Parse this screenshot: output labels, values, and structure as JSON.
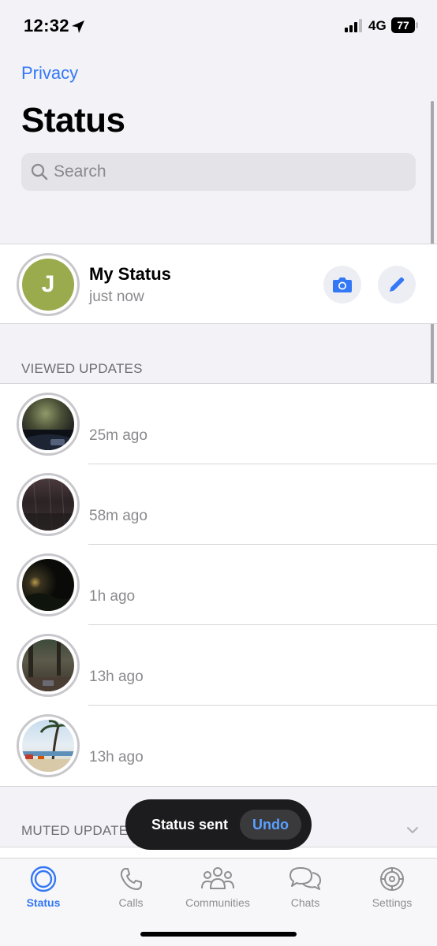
{
  "status_bar": {
    "time": "12:32",
    "network": "4G",
    "battery": "77"
  },
  "nav": {
    "privacy_label": "Privacy"
  },
  "page": {
    "title": "Status"
  },
  "search": {
    "placeholder": "Search"
  },
  "my_status": {
    "avatar_letter": "J",
    "name": "My Status",
    "subtitle": "just now"
  },
  "viewed_header": "VIEWED UPDATES",
  "updates": [
    {
      "time": "25m ago"
    },
    {
      "time": "58m ago"
    },
    {
      "time": "1h ago"
    },
    {
      "time": "13h ago"
    },
    {
      "time": "13h ago"
    }
  ],
  "muted_header": "MUTED UPDATES",
  "toast": {
    "message": "Status sent",
    "action": "Undo"
  },
  "tabs": [
    {
      "label": "Status",
      "icon": "status-icon",
      "active": true
    },
    {
      "label": "Calls",
      "icon": "phone-icon",
      "active": false
    },
    {
      "label": "Communities",
      "icon": "communities-icon",
      "active": false
    },
    {
      "label": "Chats",
      "icon": "chats-icon",
      "active": false
    },
    {
      "label": "Settings",
      "icon": "gear-icon",
      "active": false
    }
  ],
  "colors": {
    "accent": "#3478f6",
    "avatar": "#9aab4e",
    "toast_bg": "#1c1c1e"
  }
}
